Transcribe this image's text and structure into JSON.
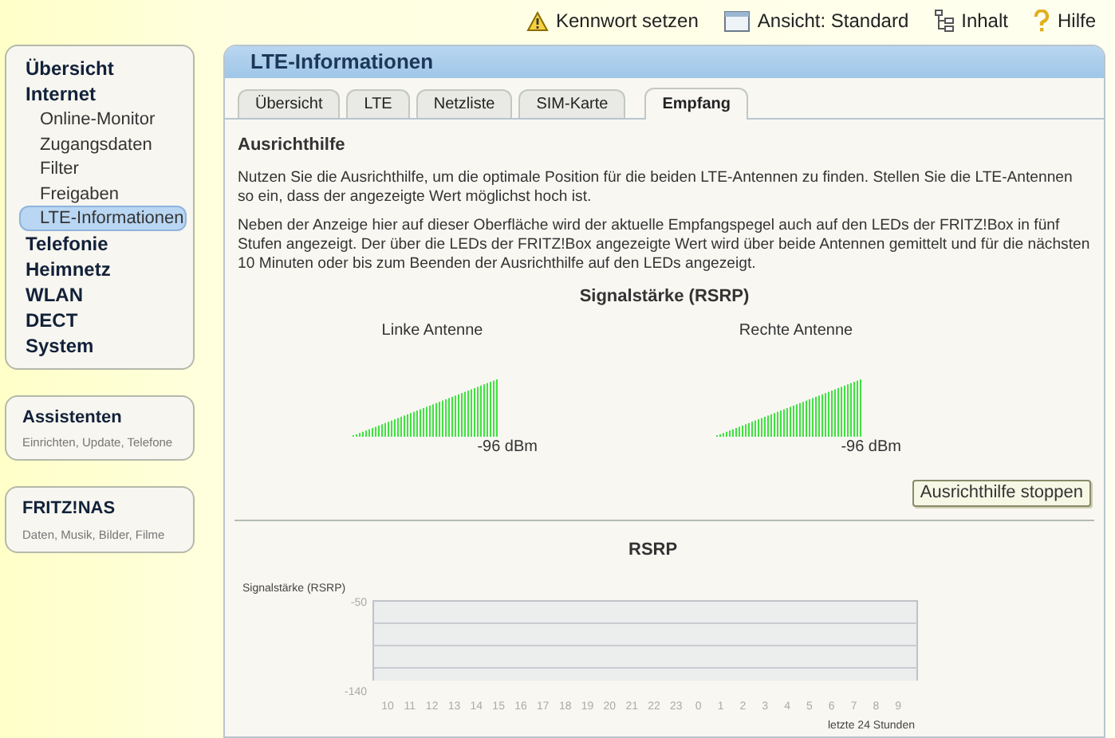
{
  "top_links": [
    {
      "kind": "warning",
      "label": "Kennwort setzen"
    },
    {
      "kind": "view",
      "label": "Ansicht: Standard"
    },
    {
      "kind": "tree",
      "label": "Inhalt"
    },
    {
      "kind": "help",
      "label": "Hilfe"
    }
  ],
  "sidebar": {
    "items": [
      {
        "label": "Übersicht",
        "selected": false
      },
      {
        "label": "Internet",
        "selected": false,
        "children": [
          {
            "label": "Online-Monitor",
            "selected": false
          },
          {
            "label": "Zugangsdaten",
            "selected": false
          },
          {
            "label": "Filter",
            "selected": false
          },
          {
            "label": "Freigaben",
            "selected": false
          },
          {
            "label": "LTE-Informationen",
            "selected": true
          }
        ]
      },
      {
        "label": "Telefonie",
        "selected": false
      },
      {
        "label": "Heimnetz",
        "selected": false
      },
      {
        "label": "WLAN",
        "selected": false
      },
      {
        "label": "DECT",
        "selected": false
      },
      {
        "label": "System",
        "selected": false
      }
    ]
  },
  "boxes": [
    {
      "title": "Assistenten",
      "subtitle": "Einrichten, Update, Telefone"
    },
    {
      "title": "FRITZ!NAS",
      "subtitle": "Daten, Musik, Bilder, Filme"
    }
  ],
  "panel": {
    "title": "LTE-Informationen",
    "tabs": [
      {
        "label": "Übersicht",
        "selected": false
      },
      {
        "label": "LTE",
        "selected": false
      },
      {
        "label": "Netzliste",
        "selected": false
      },
      {
        "label": "SIM-Karte",
        "selected": false
      },
      {
        "label": "Empfang",
        "selected": true
      }
    ],
    "heading": "Ausrichthilfe",
    "paragraphs": [
      "Nutzen Sie die Ausrichthilfe, um die optimale Position für die beiden LTE-Antennen zu finden. Stellen Sie die LTE-Antennen so ein, dass der angezeigte Wert möglichst hoch ist.",
      "Neben der Anzeige hier auf dieser Oberfläche wird der aktuelle Empfangspegel auch auf den LEDs der FRITZ!Box in fünf Stufen angezeigt. Der über die LEDs der FRITZ!Box angezeigte Wert wird über beide Antennen gemittelt und für die nächsten 10 Minuten oder bis zum Beenden der Ausrichthilfe auf den LEDs angezeigt."
    ],
    "signal_title": "Signalstärke (RSRP)",
    "antennas": [
      {
        "label": "Linke Antenne",
        "level": 1,
        "reading": "-96 dBm"
      },
      {
        "label": "Rechte Antenne",
        "level": 1,
        "reading": "-96 dBm"
      }
    ],
    "button": "Ausrichthilfe stoppen",
    "chart": {
      "chart_data": {
        "type": "line",
        "title": "RSRP",
        "ylabel": "Signalstärke (RSRP)",
        "xlabel": "letzte 24 Stunden",
        "categories": [
          "10",
          "11",
          "12",
          "13",
          "14",
          "15",
          "16",
          "17",
          "18",
          "19",
          "20",
          "21",
          "22",
          "23",
          "0",
          "1",
          "2",
          "3",
          "4",
          "5",
          "6",
          "7",
          "8",
          "9"
        ],
        "ylim": [
          -140,
          -50
        ],
        "yticks": [
          {
            "value": -50,
            "label": "-50"
          },
          {
            "value": -140,
            "label": "-140"
          }
        ]
      }
    }
  }
}
